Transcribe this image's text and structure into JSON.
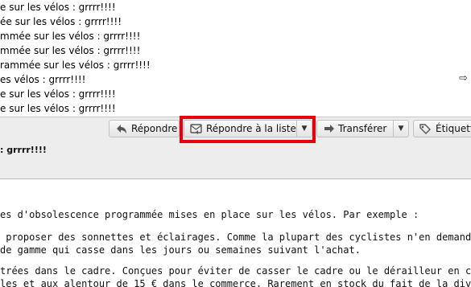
{
  "thread_list": {
    "rows": [
      "e sur les vélos : grrrr!!!!",
      "ée sur les vélos : grrrr!!!!",
      "mmée sur les vélos : grrrr!!!!",
      "mmée sur les vélos : grrrr!!!!",
      "rammée sur les vélos : grrrr!!!!",
      "es vélos : grrrr!!!!",
      "e sur les vélos : grrrr!!!!",
      "e sur les vélos : grrrr!!!!"
    ],
    "arrow": "⇨"
  },
  "toolbar": {
    "reply_label": "Répondre",
    "reply_list_label": "Répondre à la liste",
    "forward_label": "Transférer",
    "tag_label": "Étiquette",
    "dropdown_glyph": "▼"
  },
  "header": {
    "subject": ": grrrr!!!!"
  },
  "body": {
    "lines": [
      "es d'obsolescence programmée mises en place sur les vélos. Par exemple :",
      "",
      " proposer des sonnettes et éclairages. Comme la plupart des cyclistes n'en demandent",
      "de gamme qui casse dans les jours ou semaines suivant l'achat.",
      "",
      "trées dans le cadre. Conçues pour éviter de casser le cadre ou le dérailleur en cas",
      "les et aux alentour de 15 € dans le commerce. Rarement en stock du fait de la divers"
    ]
  },
  "colors": {
    "highlight": "#e8000b",
    "header_bg": "#ededed"
  }
}
